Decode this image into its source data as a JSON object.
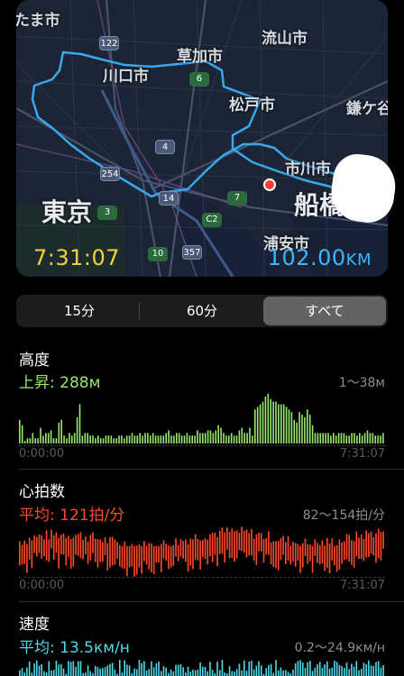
{
  "map": {
    "labels": {
      "tama": "たま市",
      "soka": "草加市",
      "nagareyama": "流山市",
      "kawaguchi": "川口市",
      "matsudo": "松戸市",
      "kamagaya": "鎌ケ谷",
      "ichikawa": "市川市",
      "funabashi": "船橋",
      "tokyo": "東京",
      "urayasu": "浦安市"
    },
    "road_badges": [
      "122",
      "6",
      "4",
      "254",
      "14",
      "7",
      "C2",
      "3",
      "10",
      "357"
    ],
    "elapsed_time": "7:31:07",
    "distance_value": "102.00",
    "distance_unit": "KM"
  },
  "segmented": {
    "items": [
      "15分",
      "60分",
      "すべて"
    ],
    "selected": "すべて"
  },
  "altitude": {
    "title": "高度",
    "summary": "上昇: 288м",
    "range": "1～38м",
    "start_time": "0:00:00",
    "end_time": "7:31:07",
    "color": "#9be870",
    "values": [
      18,
      14,
      2,
      4,
      4,
      8,
      4,
      4,
      12,
      6,
      8,
      8,
      10,
      4,
      4,
      16,
      18,
      6,
      4,
      8,
      6,
      8,
      20,
      30,
      6,
      8,
      8,
      6,
      6,
      4,
      6,
      4,
      4,
      6,
      6,
      6,
      4,
      4,
      6,
      6,
      4,
      6,
      6,
      8,
      6,
      6,
      8,
      6,
      8,
      8,
      6,
      8,
      6,
      6,
      6,
      6,
      8,
      10,
      6,
      6,
      8,
      8,
      6,
      6,
      8,
      6,
      6,
      6,
      10,
      8,
      8,
      8,
      10,
      10,
      8,
      10,
      14,
      12,
      8,
      6,
      6,
      8,
      6,
      6,
      10,
      12,
      8,
      8,
      12,
      6,
      26,
      28,
      30,
      32,
      36,
      38,
      34,
      32,
      32,
      30,
      30,
      30,
      28,
      26,
      24,
      18,
      16,
      24,
      22,
      20,
      26,
      22,
      14,
      8,
      8,
      8,
      8,
      8,
      8,
      6,
      8,
      6,
      8,
      8,
      8,
      6,
      6,
      8,
      8,
      6,
      8,
      6,
      8,
      10,
      8,
      8,
      6,
      6,
      6,
      8
    ]
  },
  "heart_rate": {
    "title": "心拍数",
    "summary": "平均: 121拍/分",
    "range": "82～154拍/分",
    "start_time": "0:00:00",
    "end_time": "7:31:07",
    "color": "#ff4a2a"
  },
  "speed": {
    "title": "速度",
    "summary": "平均: 13.5км/н",
    "range": "0.2～24.9км/н",
    "color": "#4fd8e6"
  }
}
